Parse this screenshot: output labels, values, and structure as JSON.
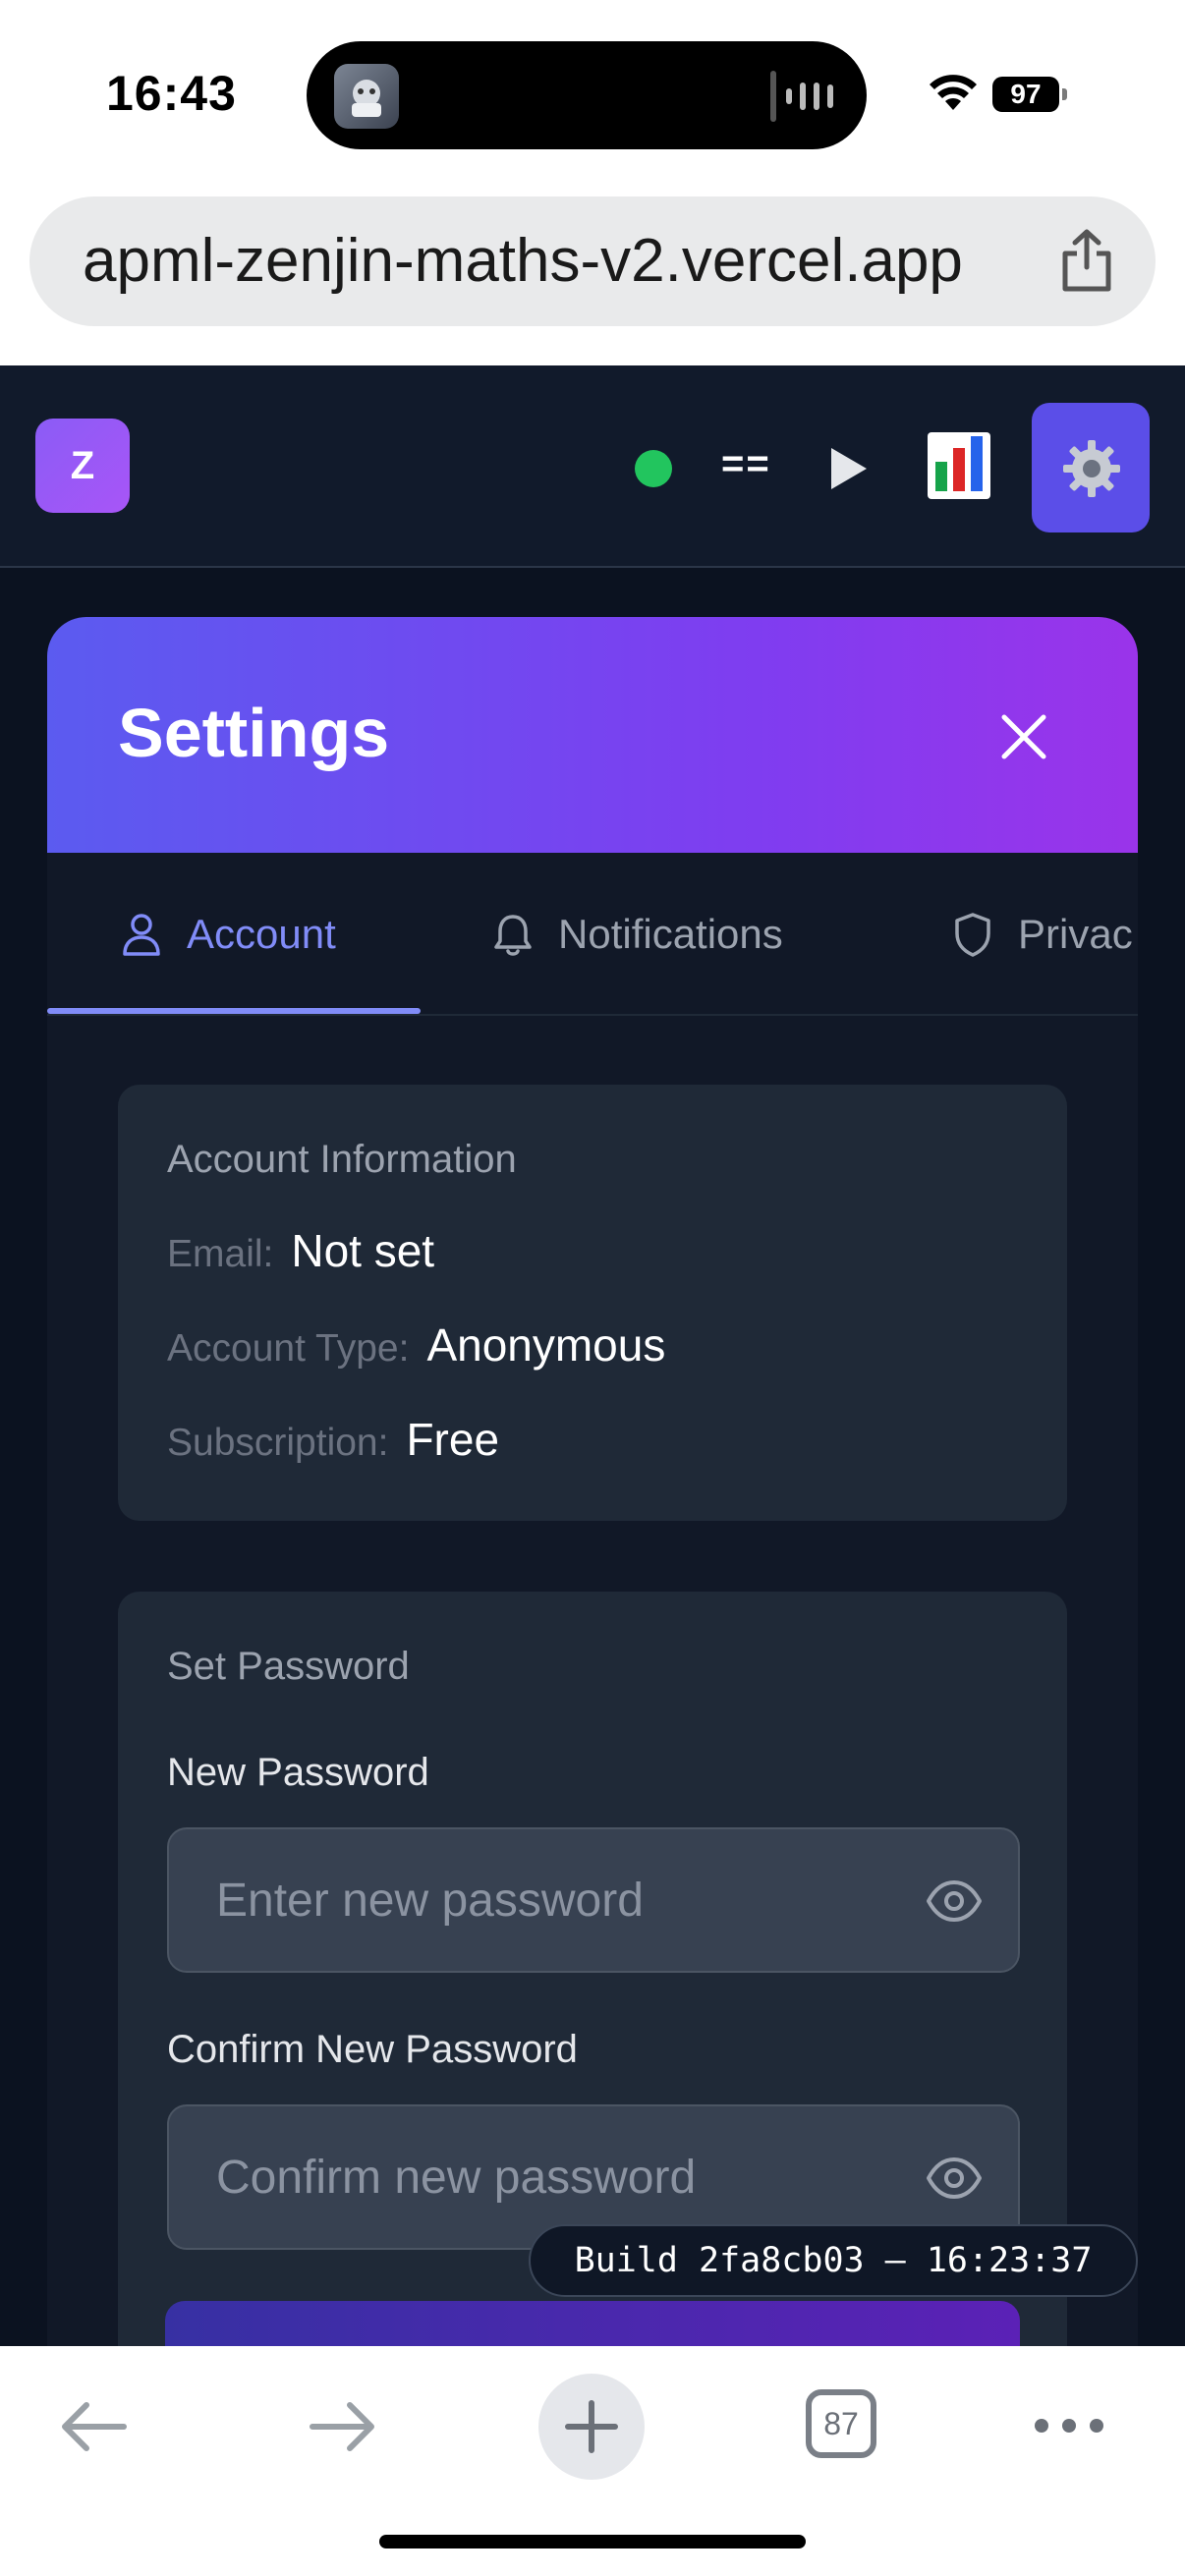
{
  "status_bar": {
    "time": "16:43",
    "battery": "97"
  },
  "browser": {
    "url": "apml-zenjin-maths-v2.vercel.app",
    "tab_count": "87"
  },
  "app_header": {
    "logo_letter": "Z",
    "status_dot_color": "#22c55e",
    "eq_label": "=="
  },
  "settings": {
    "title": "Settings",
    "tabs": [
      {
        "label": "Account",
        "icon": "user-icon",
        "active": true
      },
      {
        "label": "Notifications",
        "icon": "bell-icon",
        "active": false
      },
      {
        "label": "Privac",
        "icon": "shield-icon",
        "active": false
      }
    ],
    "account_info": {
      "title": "Account Information",
      "email_label": "Email:",
      "email_value": "Not set",
      "type_label": "Account Type:",
      "type_value": "Anonymous",
      "subscription_label": "Subscription:",
      "subscription_value": "Free"
    },
    "password": {
      "title": "Set Password",
      "new_label": "New Password",
      "new_placeholder": "Enter new password",
      "confirm_label": "Confirm New Password",
      "confirm_placeholder": "Confirm new password"
    }
  },
  "build_badge": "Build 2fa8cb03 – 16:23:37",
  "colors": {
    "accent": "#818cf8",
    "header_gradient_start": "#5b5bf0",
    "header_gradient_end": "#9a34ea",
    "background": "#0b1220",
    "card": "#1f2937"
  }
}
